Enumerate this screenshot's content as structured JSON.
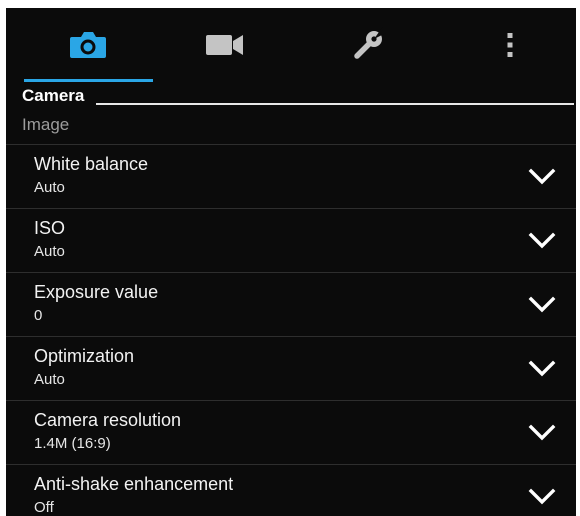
{
  "colors": {
    "accent": "#2aa6e6",
    "background": "#0b0b0b",
    "muted_text": "#9c9c9c",
    "divider": "#2e2e2e"
  },
  "tabs": [
    {
      "icon": "camera-icon",
      "selected": true
    },
    {
      "icon": "video-camera-icon",
      "selected": false
    },
    {
      "icon": "wrench-icon",
      "selected": false
    },
    {
      "icon": "more-vertical-icon",
      "selected": false
    }
  ],
  "section": {
    "title": "Camera"
  },
  "group": {
    "label": "Image"
  },
  "items": [
    {
      "label": "White balance",
      "value": "Auto"
    },
    {
      "label": "ISO",
      "value": "Auto"
    },
    {
      "label": "Exposure value",
      "value": "0"
    },
    {
      "label": "Optimization",
      "value": "Auto"
    },
    {
      "label": "Camera resolution",
      "value": "1.4M (16:9)"
    },
    {
      "label": "Anti-shake enhancement",
      "value": "Off"
    }
  ]
}
